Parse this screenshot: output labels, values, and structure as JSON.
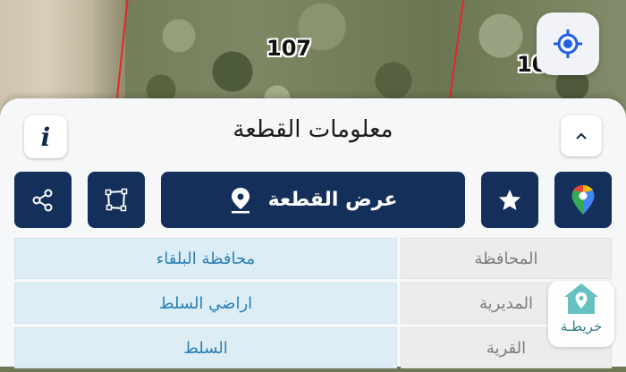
{
  "map": {
    "parcel_numbers": [
      "107",
      "10"
    ]
  },
  "sheet": {
    "title": "معلومات القطعة",
    "show_parcel_label": "عرض القطعة"
  },
  "details": [
    {
      "label": "المحافظة",
      "value": "محافظة البلقاء"
    },
    {
      "label": "المديرية",
      "value": "اراضي السلط"
    },
    {
      "label": "القرية",
      "value": "السلط"
    }
  ],
  "map_fab": {
    "label": "خريطـة"
  },
  "icons": {
    "locate": "crosshair-icon",
    "info": "info-icon",
    "collapse": "chevron-up-icon",
    "share": "share-icon",
    "polygon": "polygon-icon",
    "location_pin": "location-pin-icon",
    "favorite": "star-badge-icon",
    "google_maps": "google-maps-icon",
    "home_map": "home-map-icon"
  },
  "colors": {
    "primary": "#14305a",
    "value_text": "#2a7fb5",
    "parcel_border": "#e3262d"
  }
}
